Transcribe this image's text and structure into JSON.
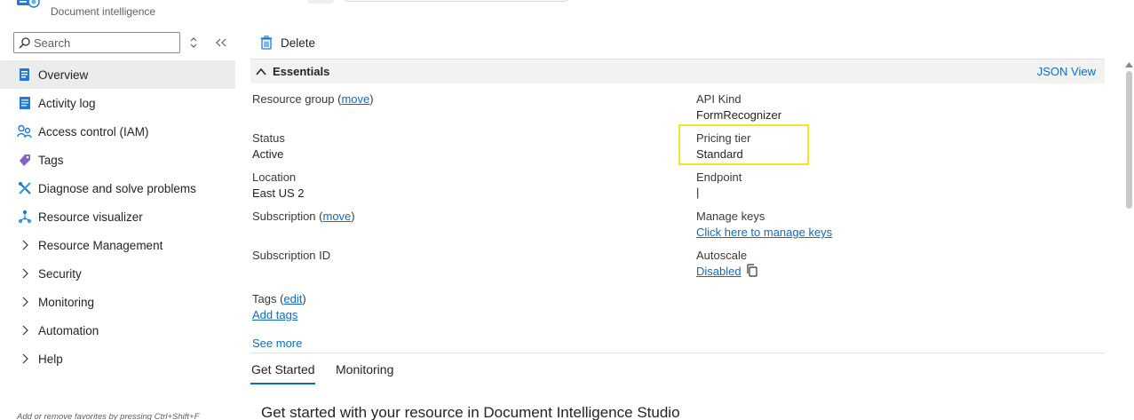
{
  "service": {
    "label": "Document intelligence",
    "icon": "document-intelligence-icon"
  },
  "sidebar": {
    "search_placeholder": "Search",
    "items": [
      {
        "label": "Overview",
        "icon": "overview-icon",
        "active": true
      },
      {
        "label": "Activity log",
        "icon": "activity-log-icon"
      },
      {
        "label": "Access control (IAM)",
        "icon": "people-icon"
      },
      {
        "label": "Tags",
        "icon": "tag-icon"
      },
      {
        "label": "Diagnose and solve problems",
        "icon": "wrench-icon"
      },
      {
        "label": "Resource visualizer",
        "icon": "hierarchy-icon"
      },
      {
        "label": "Resource Management",
        "icon": "chevron-right-icon"
      },
      {
        "label": "Security",
        "icon": "chevron-right-icon"
      },
      {
        "label": "Monitoring",
        "icon": "chevron-right-icon"
      },
      {
        "label": "Automation",
        "icon": "chevron-right-icon"
      },
      {
        "label": "Help",
        "icon": "chevron-right-icon"
      }
    ],
    "favorites_hint": "Add or remove favorites by pressing Ctrl+Shift+F"
  },
  "toolbar": {
    "delete_label": "Delete"
  },
  "essentials": {
    "title": "Essentials",
    "json_view": "JSON View",
    "left": {
      "resource_group_label": "Resource group",
      "resource_group_move": "move",
      "status_label": "Status",
      "status_value": "Active",
      "location_label": "Location",
      "location_value": "East US 2",
      "subscription_label": "Subscription",
      "subscription_move": "move",
      "subscription_id_label": "Subscription ID",
      "tags_label": "Tags",
      "tags_edit": "edit",
      "add_tags": "Add tags"
    },
    "right": {
      "api_kind_label": "API Kind",
      "api_kind_value": "FormRecognizer",
      "pricing_tier_label": "Pricing tier",
      "pricing_tier_value": "Standard",
      "endpoint_label": "Endpoint",
      "endpoint_value": "|",
      "manage_keys_label": "Manage keys",
      "manage_keys_link": "Click here to manage keys",
      "autoscale_label": "Autoscale",
      "autoscale_value": "Disabled"
    },
    "see_more": "See more"
  },
  "tabs": [
    {
      "label": "Get Started",
      "active": true
    },
    {
      "label": "Monitoring",
      "active": false
    }
  ],
  "section_title": "Get started with your resource in Document Intelligence Studio",
  "colors": {
    "accent": "#0f6cbd",
    "highlight": "#f5e52a",
    "active_nav": "#ececec"
  }
}
